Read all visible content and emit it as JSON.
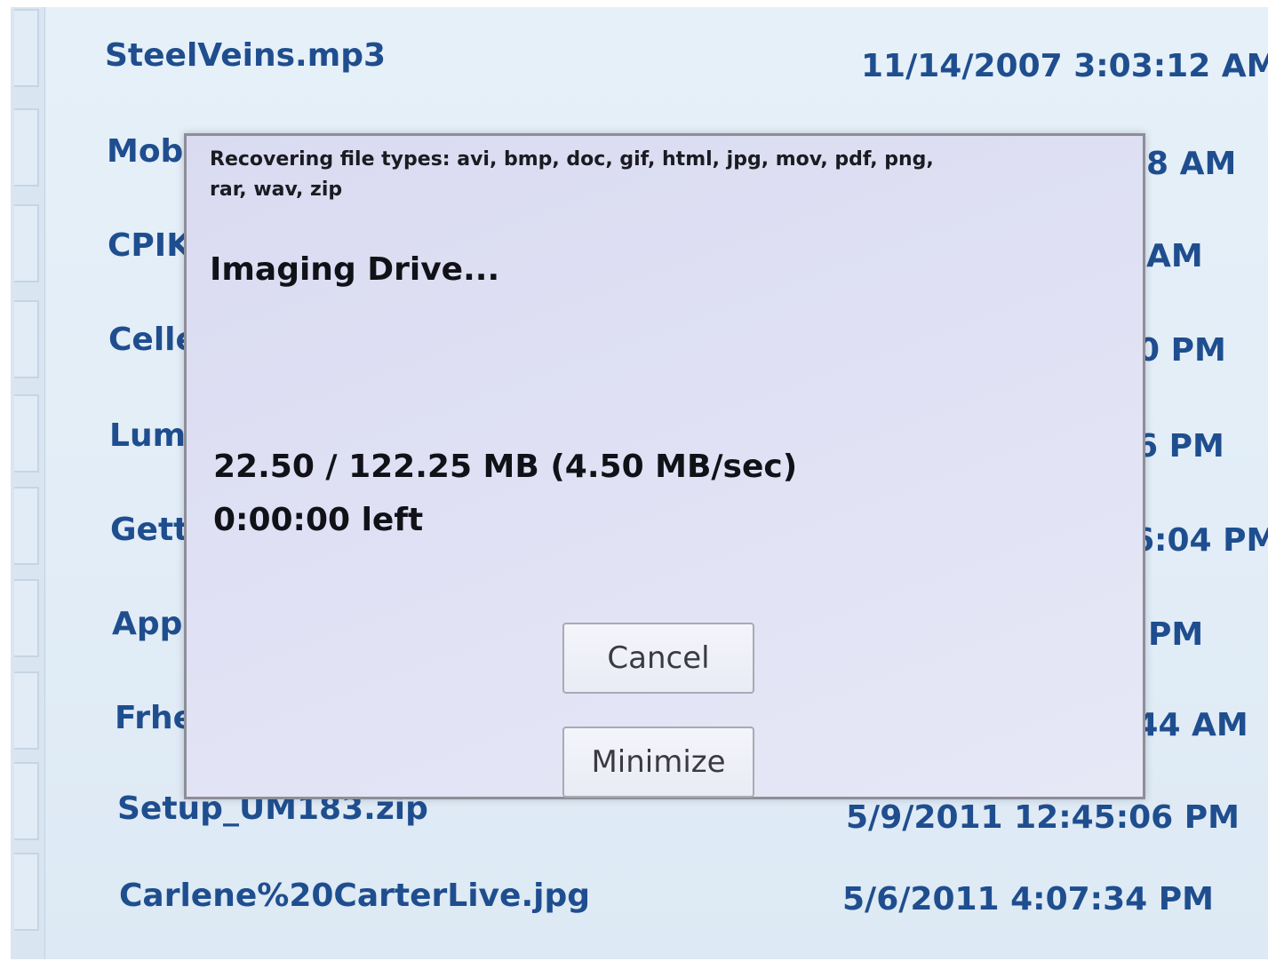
{
  "file_list": {
    "rows": [
      {
        "name": "SteelVeins.mp3",
        "date": "11/14/2007 3:03:12 AM"
      },
      {
        "name": "Mob",
        "date": "8 AM"
      },
      {
        "name": "CPIK",
        "date": "AM"
      },
      {
        "name": "Celle",
        "date": "0 PM"
      },
      {
        "name": "Lumi",
        "date": "6 PM"
      },
      {
        "name": "Getti",
        "date": "6:04 PM"
      },
      {
        "name": "Appl",
        "date": "PM"
      },
      {
        "name": "Frhe",
        "date": ":44 AM"
      },
      {
        "name": "Setup_UM183.zip",
        "date": "5/9/2011 12:45:06 PM"
      },
      {
        "name": "Carlene%20CarterLive.jpg",
        "date": "5/6/2011 4:07:34 PM"
      }
    ]
  },
  "dialog": {
    "file_types": "Recovering file types: avi, bmp, doc, gif, html, jpg, mov, pdf, png, rar, wav, zip",
    "status_title": "Imaging Drive...",
    "progress_text": "22.50 / 122.25 MB (4.50 MB/sec)",
    "time_left": "0:00:00 left",
    "progress": {
      "done_mb": 22.5,
      "total_mb": 122.25,
      "rate_mb_per_sec": 4.5
    },
    "cancel_label": "Cancel",
    "minimize_label": "Minimize"
  },
  "colors": {
    "file_text": "#1f4e8f",
    "screen_background": "#e2edf7",
    "dialog_background": "#e0e1f4",
    "dialog_text": "#111118"
  }
}
